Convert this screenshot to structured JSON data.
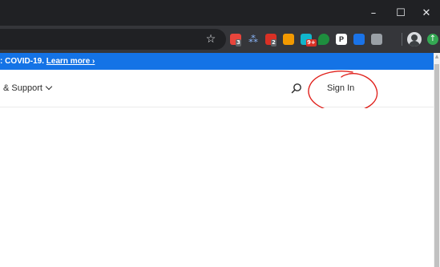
{
  "window": {
    "minimize_glyph": "–",
    "maximize_glyph": "☐",
    "close_glyph": "✕"
  },
  "toolbar": {
    "bookmark_glyph": "☆",
    "extensions": [
      {
        "icon": "red-extension-icon",
        "color": "#e8453c",
        "badge": "3"
      },
      {
        "icon": "dropbox-icon",
        "color": "#8ab4f8",
        "badge": ""
      },
      {
        "icon": "adblock-icon",
        "color": "#d93025",
        "badge": "2"
      },
      {
        "icon": "orange-extension-icon",
        "color": "#f29900",
        "badge": ""
      },
      {
        "icon": "teal-extension-icon",
        "color": "#12b5cb",
        "badge": "9+"
      },
      {
        "icon": "green-leaf-icon",
        "color": "#1e8e3e",
        "badge": ""
      },
      {
        "icon": "p-extension-icon",
        "color": "#202124",
        "badge": ""
      },
      {
        "icon": "blue-extension-icon",
        "color": "#1a73e8",
        "badge": ""
      },
      {
        "icon": "grey-extension-icon",
        "color": "#9aa0a6",
        "badge": ""
      }
    ],
    "extension_p_label": "P",
    "update_glyph": "↑"
  },
  "banner": {
    "text": ": COVID-19.",
    "link": "Learn more ›",
    "color": "#1473e6"
  },
  "nav": {
    "help_support": "& Support",
    "sign_in": "Sign In"
  },
  "annotation": {
    "color": "#e0201b"
  }
}
